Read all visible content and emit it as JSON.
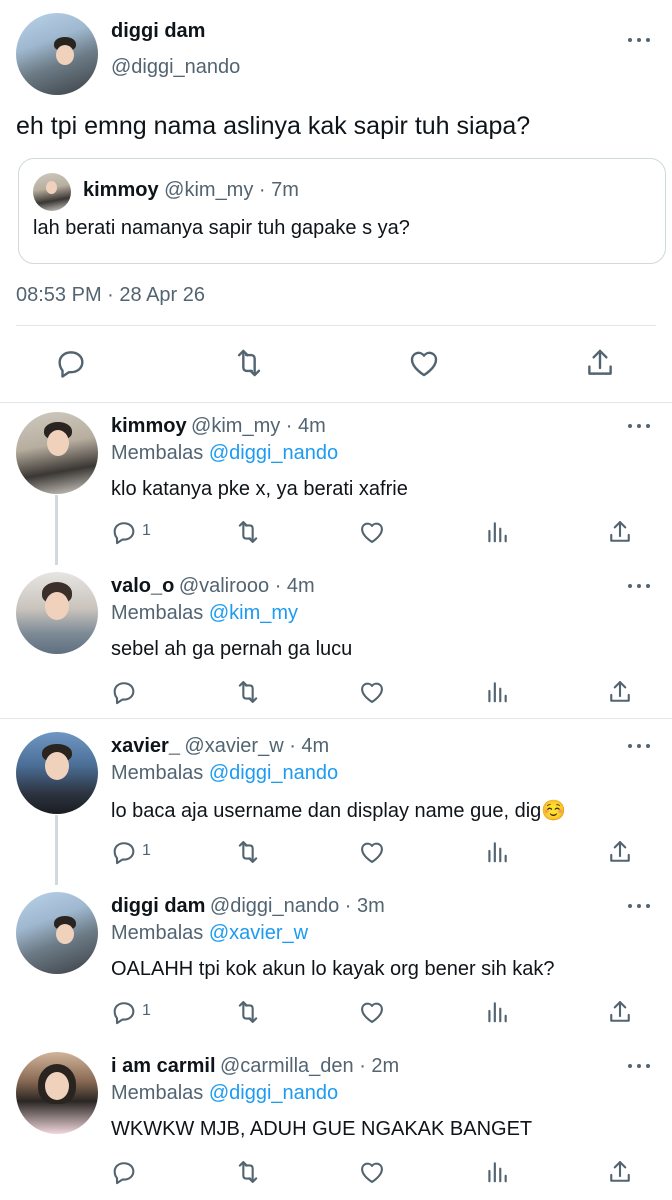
{
  "main_tweet": {
    "name": "diggi dam",
    "handle": "@diggi_nando",
    "text": "eh tpi emng nama aslinya kak sapir tuh siapa?",
    "quote": {
      "name": "kimmoy",
      "meta": "@kim_my · 7m",
      "text": "lah berati namanya sapir tuh gapake s ya?"
    },
    "timestamp": "08:53 PM · 28 Apr 26"
  },
  "replies": [
    {
      "name": "kimmoy",
      "meta": "@kim_my · 4m",
      "replying_prefix": "Membalas",
      "replying_to": "@diggi_nando",
      "text": "klo katanya pke x, ya berati xafrie",
      "reply_count": "1"
    },
    {
      "name": "valo_o",
      "meta": "@valirooo · 4m",
      "replying_prefix": "Membalas",
      "replying_to": "@kim_my",
      "text": "sebel ah ga pernah ga lucu",
      "reply_count": ""
    },
    {
      "name": "xavier_",
      "meta": "@xavier_w · 4m",
      "replying_prefix": "Membalas",
      "replying_to": "@diggi_nando",
      "text": "lo baca aja username dan display name gue, dig☺️",
      "reply_count": "1"
    },
    {
      "name": "diggi dam",
      "meta": "@diggi_nando · 3m",
      "replying_prefix": "Membalas",
      "replying_to": "@xavier_w",
      "text": "OALAHH tpi kok akun lo kayak org bener sih kak?",
      "reply_count": "1"
    },
    {
      "name": "i am carmil",
      "meta": "@carmilla_den · 2m",
      "replying_prefix": "Membalas",
      "replying_to": "@diggi_nando",
      "text": "WKWKW MJB, ADUH GUE NGAKAK BANGET",
      "reply_count": ""
    }
  ],
  "icons": {
    "reply": "reply-icon",
    "retweet": "retweet-icon",
    "like": "heart-icon",
    "views": "views-icon",
    "share": "share-icon",
    "more": "more-icon"
  },
  "colors": {
    "link": "#1d9bf0",
    "muted": "#536471",
    "text": "#0f1419",
    "divider": "#e1e8ed"
  }
}
